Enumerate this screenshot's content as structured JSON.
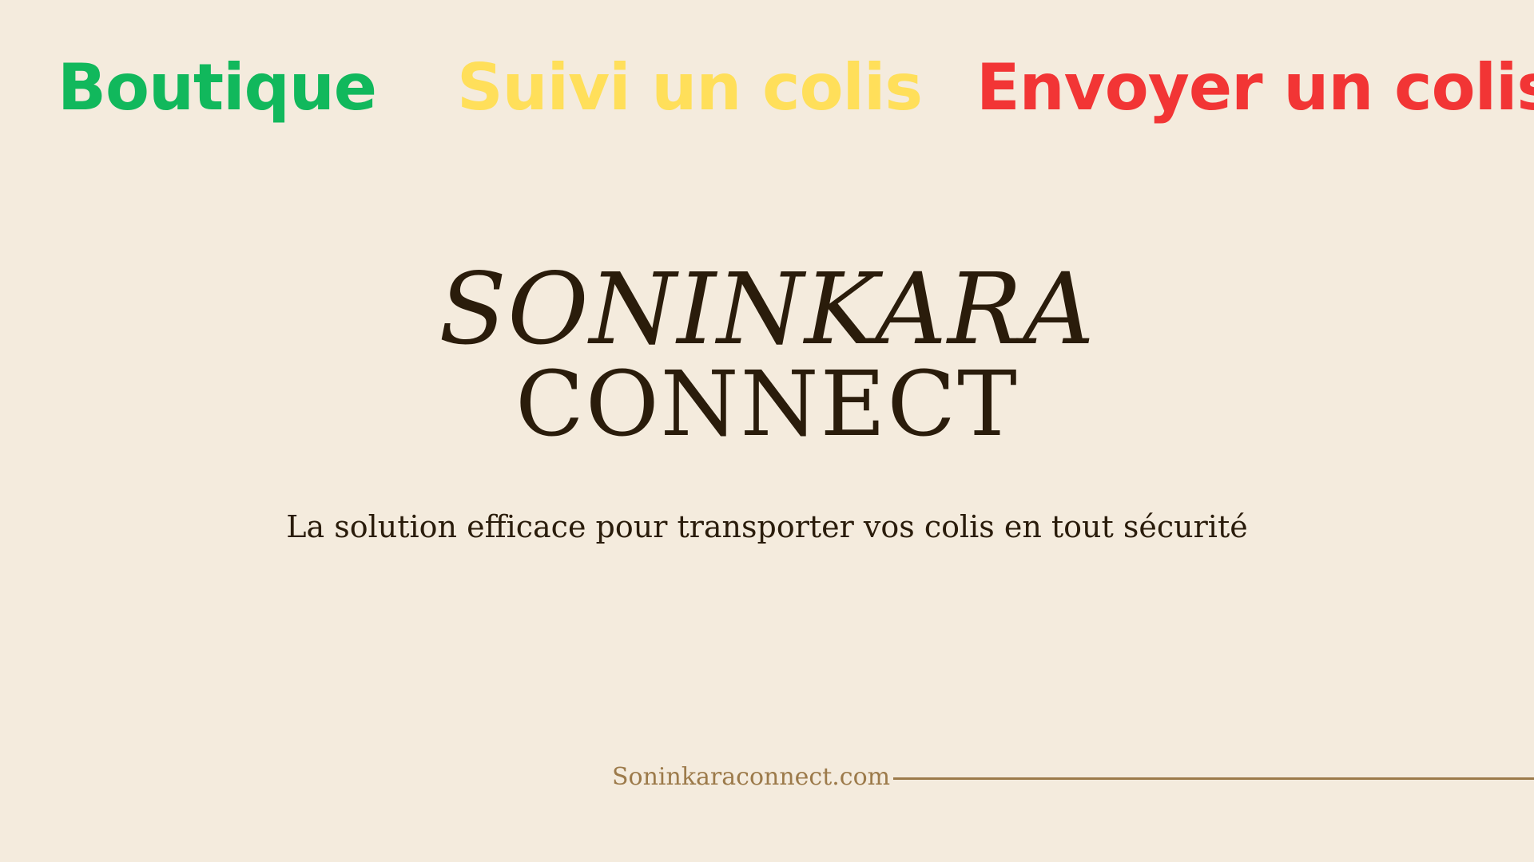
{
  "nav": {
    "boutique": {
      "label": "Boutique",
      "color": "#11b85c"
    },
    "suivi": {
      "label": "Suivi un colis",
      "color": "#ffdf5a"
    },
    "envoyer": {
      "label": "Envoyer un colis",
      "color": "#f23535"
    }
  },
  "brand": {
    "line1": "SONINKARA",
    "line2": "CONNECT",
    "color": "#2a1c0b"
  },
  "tagline": "La solution efficace pour transporter vos colis en tout sécurité",
  "footer": {
    "url": "Soninkaraconnect.com",
    "color": "#9c7a4a"
  },
  "background_color": "#f4ebdd"
}
